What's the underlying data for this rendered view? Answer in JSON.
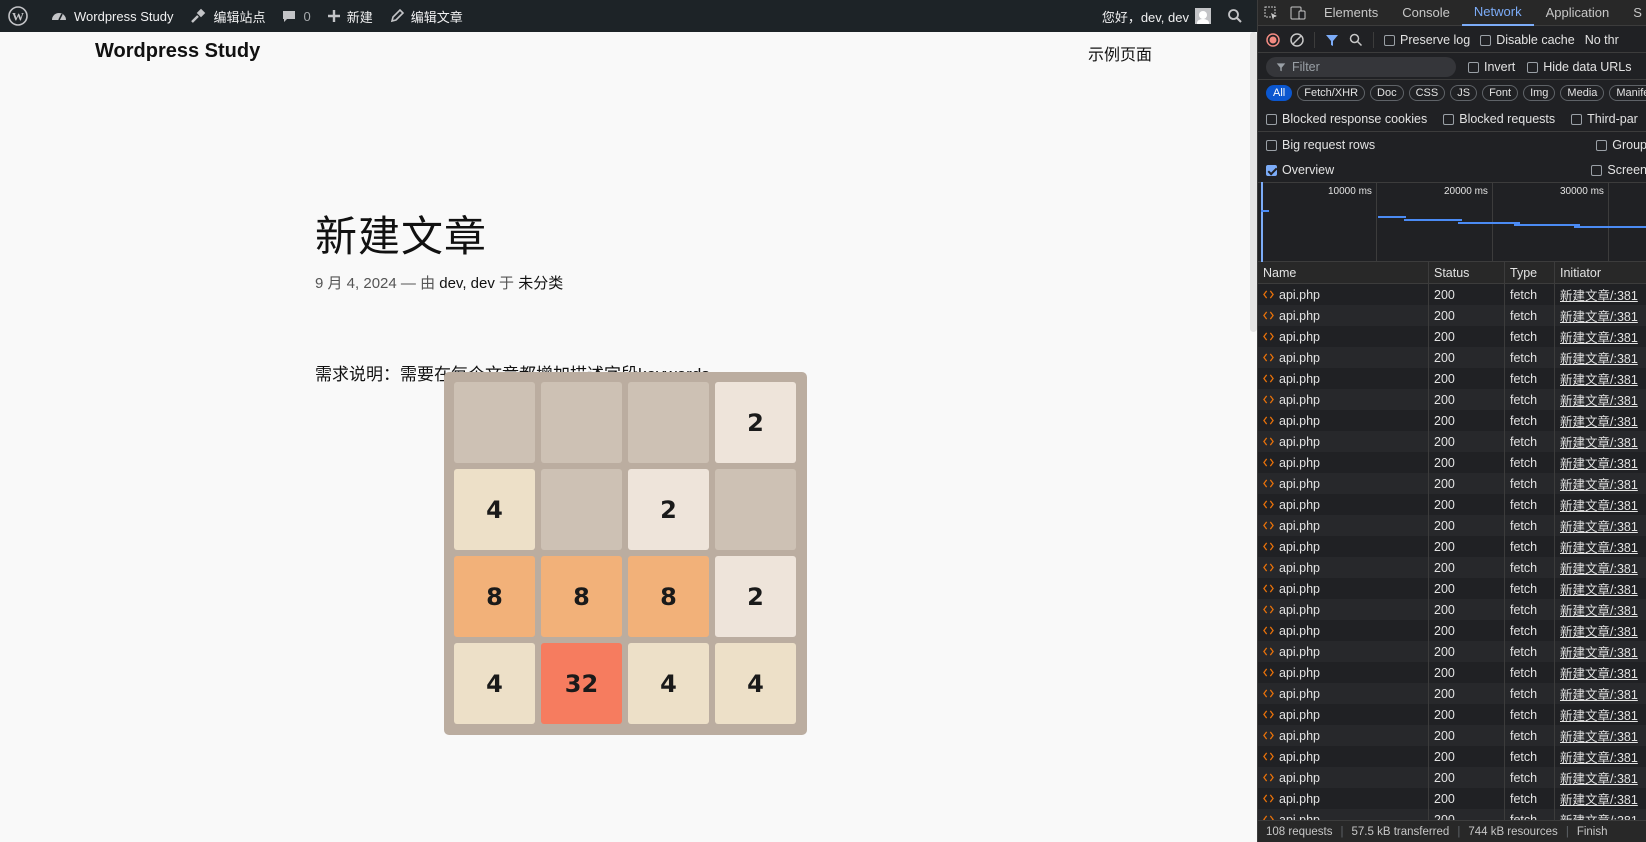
{
  "adminbar": {
    "site_name": "Wordpress Study",
    "customize_label": "编辑站点",
    "comments_count": "0",
    "new_label": "新建",
    "edit_label": "编辑文章",
    "greeting": "您好，dev, dev"
  },
  "site": {
    "title": "Wordpress Study",
    "nav_item": "示例页面"
  },
  "post": {
    "title": "新建文章",
    "date": "9 月 4, 2024",
    "meta_sep": "— 由",
    "author": "dev, dev",
    "in_label": "于",
    "category": "未分类",
    "body": "需求说明：需要在每个文章都增加描述字段keywords"
  },
  "game": {
    "tiles": [
      [
        "",
        "",
        "",
        "2"
      ],
      [
        "4",
        "",
        "2",
        ""
      ],
      [
        "8",
        "8",
        "8",
        "2"
      ],
      [
        "4",
        "32",
        "4",
        "4"
      ]
    ]
  },
  "devtools": {
    "tabs": [
      "Elements",
      "Console",
      "Network",
      "Application",
      "S"
    ],
    "active_tab": "Network",
    "preserve_log": "Preserve log",
    "disable_cache": "Disable cache",
    "throttle": "No thr",
    "filter_placeholder": "Filter",
    "invert": "Invert",
    "hide_data_urls": "Hide data URLs",
    "types": [
      "All",
      "Fetch/XHR",
      "Doc",
      "CSS",
      "JS",
      "Font",
      "Img",
      "Media",
      "Manifes"
    ],
    "blocked_cookies": "Blocked response cookies",
    "blocked_requests": "Blocked requests",
    "third_party": "Third-par",
    "big_rows": "Big request rows",
    "group": "Group",
    "overview": "Overview",
    "screenshots": "Screen",
    "timeline_labels": [
      "10000 ms",
      "20000 ms",
      "30000 ms"
    ],
    "columns": [
      "Name",
      "Status",
      "Type",
      "Initiator"
    ],
    "row_template": {
      "name": "api.php",
      "status": "200",
      "type": "fetch",
      "initiator": "新建文章/:381"
    },
    "row_count": 26,
    "status_bar": [
      "108 requests",
      "57.5 kB transferred",
      "744 kB resources",
      "Finish"
    ]
  },
  "colors": {
    "adminbar_bg": "#1d2327",
    "board_bg": "#bbada0",
    "tile_empty": "#cdc1b4",
    "tile_2": "#eee4da",
    "tile_4": "#ede0c8",
    "tile_8": "#f2b179",
    "tile_32": "#f67c5f",
    "devtools_accent": "#7cacf8"
  }
}
